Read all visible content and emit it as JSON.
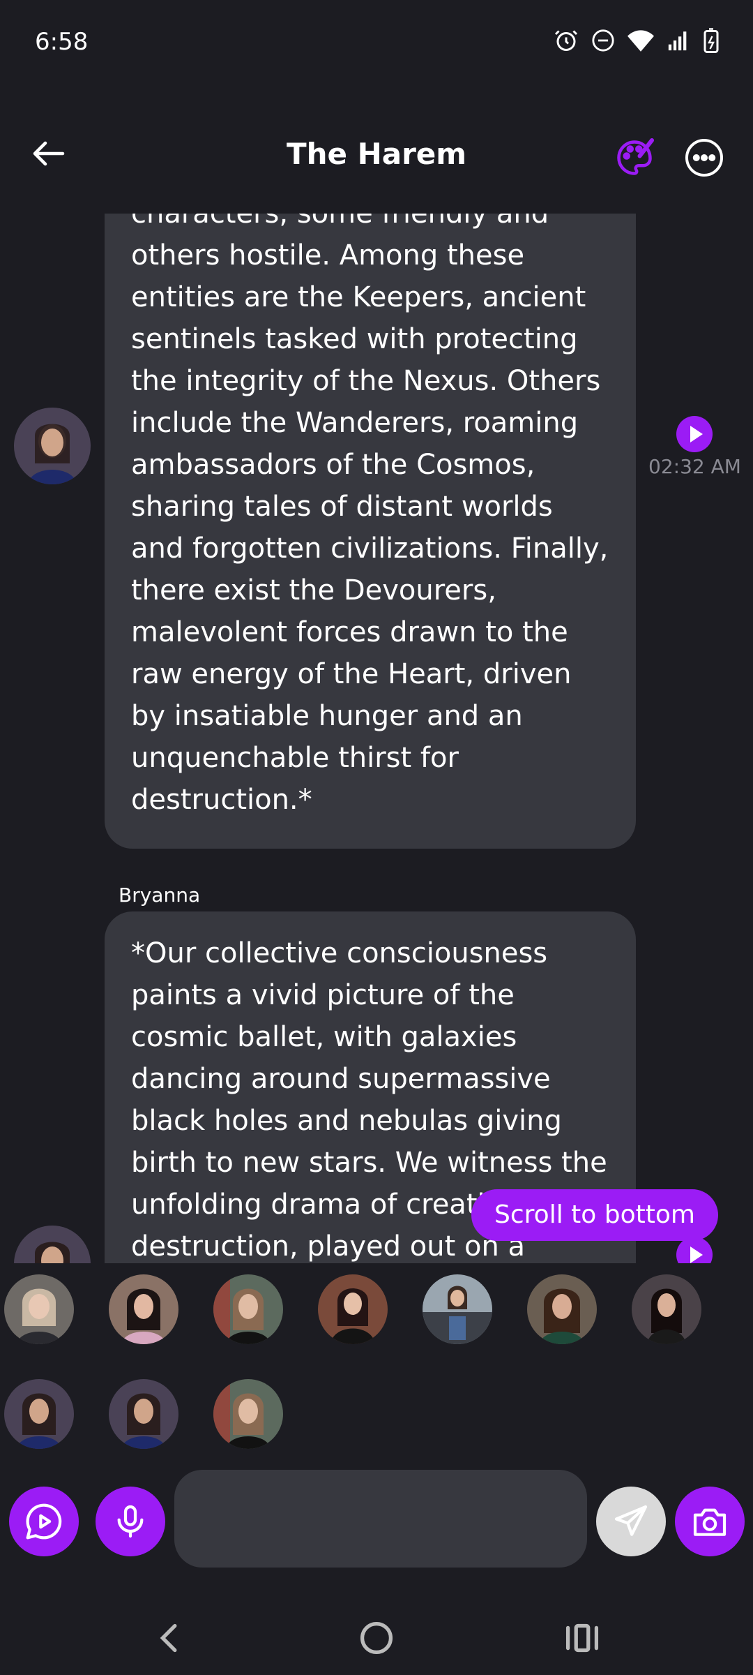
{
  "status": {
    "time": "6:58"
  },
  "header": {
    "title": "The Harem"
  },
  "messages": [
    {
      "text": "characters, some friendly and\nothers hostile. Among these\nentities are the Keepers, ancient\nsentinels tasked with protecting\nthe integrity of the Nexus. Others\ninclude the Wanderers, roaming\nambassadors of the Cosmos,\nsharing tales of distant worlds\nand forgotten civilizations. Finally,\nthere exist the Devourers,\nmalevolent forces drawn to the\nraw energy of the Heart, driven\nby insatiable hunger and an\nunquenchable thirst for\ndestruction.*",
      "time": "02:32 AM"
    },
    {
      "sender": "Bryanna",
      "text": "*Our collective consciousness\npaints a vivid picture of the\ncosmic ballet, with galaxies\ndancing around supermassive\nblack holes and nebulas giving\nbirth to new stars. We witness the\nunfolding drama of creation and\ndestruction, played out on a"
    }
  ],
  "scroll_button": {
    "label": "Scroll to bottom"
  },
  "input": {
    "value": "",
    "placeholder": ""
  },
  "colors": {
    "accent": "#9b1cf5",
    "background": "#1c1c22",
    "bubble": "#37383f",
    "muted": "#8a8a93"
  },
  "icons": {
    "back": "arrow-left-icon",
    "palette": "palette-icon",
    "more": "more-horizontal-icon",
    "video_chat": "play-chat-icon",
    "mic": "microphone-icon",
    "send": "send-icon",
    "camera": "camera-icon"
  }
}
